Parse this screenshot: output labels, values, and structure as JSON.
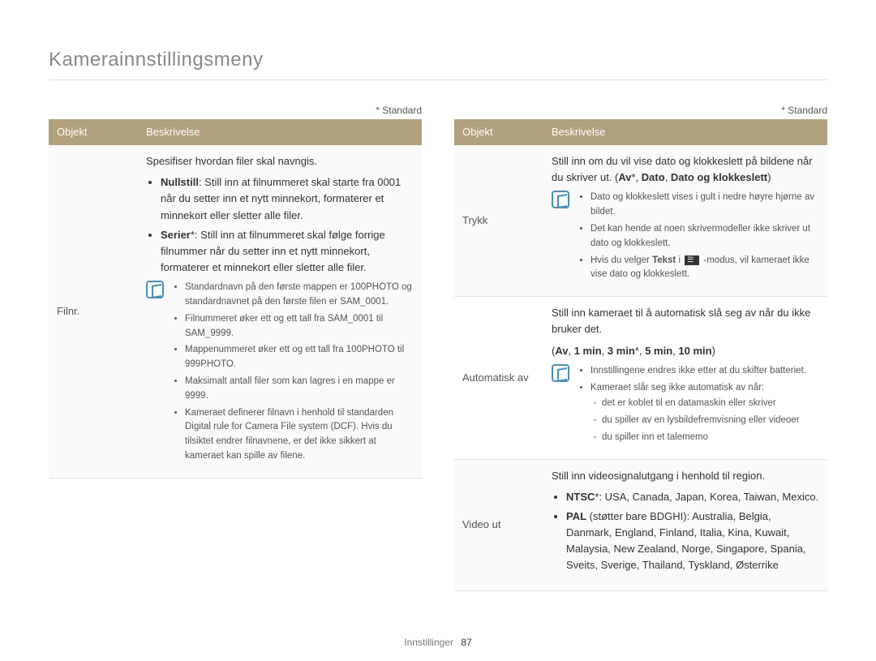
{
  "title": "Kamerainnstillingsmeny",
  "standard_label": "* Standard",
  "footer": {
    "section": "Innstillinger",
    "page": "87"
  },
  "headers": {
    "objekt": "Objekt",
    "beskrivelse": "Beskrivelse"
  },
  "left": {
    "row1": {
      "label": "Filnr.",
      "intro": "Spesifiser hvordan filer skal navngis.",
      "b1_strong": "Nullstill",
      "b1_rest": ": Still inn at filnummeret skal starte fra 0001 når du setter inn et nytt minnekort, formaterer et minnekort eller sletter alle filer.",
      "b2_strong": "Serier",
      "b2_rest": "*: Still inn at filnummeret skal følge forrige filnummer når du setter inn et nytt minnekort, formaterer et minnekort eller sletter alle filer.",
      "notes": {
        "n1": "Standardnavn på den første mappen er 100PHOTO og standardnavnet på den første filen er SAM_0001.",
        "n2": "Filnummeret øker ett og ett tall fra SAM_0001 til SAM_9999.",
        "n3": "Mappenummeret øker ett og ett tall fra 100PHOTO til 999PHOTO.",
        "n4": "Maksimalt antall filer som kan lagres i en mappe er 9999.",
        "n5": "Kameraet definerer filnavn i henhold til standarden Digital rule for Camera File system (DCF). Hvis du tilsiktet endrer filnavnene, er det ikke sikkert at kameraet kan spille av filene."
      }
    }
  },
  "right": {
    "row1": {
      "label": "Trykk",
      "intro_a": "Still inn om du vil vise dato og klokkeslett på bildene når du skriver ut. (",
      "opt1": "Av",
      "sep": "*, ",
      "opt2": "Dato",
      "sep2": ", ",
      "opt3": "Dato og klokkeslett",
      "intro_b": ")",
      "notes": {
        "n1": "Dato og klokkeslett vises i gult i nedre høyre hjørne av bildet.",
        "n2": "Det kan hende at noen skrivermodeller ikke skriver ut dato og klokkeslett.",
        "n3a": "Hvis du velger ",
        "n3b": "Tekst",
        "n3c": " i ",
        "n3d": " -modus, vil kameraet ikke vise dato og klokkeslett."
      }
    },
    "row2": {
      "label": "Automatisk av",
      "intro": "Still inn kameraet til å automatisk slå seg av når du ikke bruker det.",
      "opts_a": "(",
      "opt1": "Av",
      "s1": ", ",
      "opt2": "1 min",
      "s2": ", ",
      "opt3": "3 min",
      "s3": "*, ",
      "opt4": "5 min",
      "s4": ", ",
      "opt5": "10 min",
      "opts_b": ")",
      "notes": {
        "n1": "Innstillingene endres ikke etter at du skifter batteriet.",
        "n2": "Kameraet slår seg ikke automatisk av når:",
        "n2a": "det er koblet til en datamaskin eller skriver",
        "n2b": "du spiller av en lysbildefremvisning eller videoer",
        "n2c": "du spiller inn et talememo"
      }
    },
    "row3": {
      "label": "Video ut",
      "intro": "Still inn videosignalutgang i henhold til region.",
      "b1_strong": "NTSC",
      "b1_rest": "*: USA, Canada, Japan, Korea, Taiwan, Mexico.",
      "b2_strong": "PAL",
      "b2_rest": " (støtter bare BDGHI): Australia, Belgia, Danmark, England, Finland, Italia, Kina, Kuwait, Malaysia, New Zealand, Norge, Singapore, Spania, Sveits, Sverige, Thailand, Tyskland, Østerrike"
    }
  }
}
